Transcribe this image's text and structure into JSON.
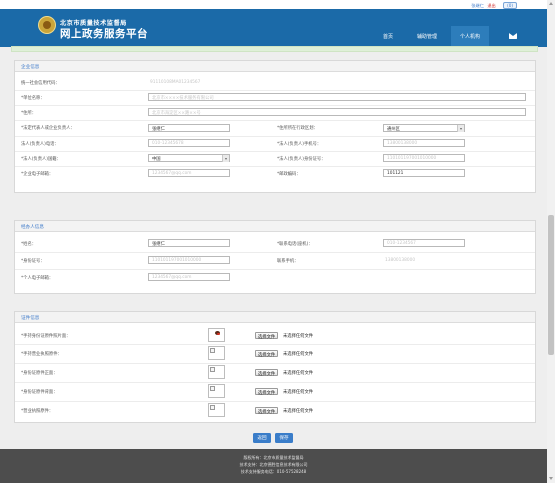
{
  "topbar": {
    "user": "张继仁",
    "logout": "退出",
    "badge": "(0)"
  },
  "header": {
    "org_name": "北京市质量技术监督局",
    "platform_name": "网上政务服务平台",
    "nav": [
      "首页",
      "辅助管理",
      "个人机构"
    ],
    "active_nav": "个人机构"
  },
  "enterprise": {
    "section_title": "企业信息",
    "credit_code_label": "统一社会信用代码：",
    "credit_code_value": "91110108MA01234567",
    "unit_name_label": "*单位名称：",
    "unit_name_value": "北京市××××技术服务有限公司",
    "address_label": "*住所：",
    "address_value": "北京市海淀区××路××号",
    "legal_rep_label": "*法定代表人或企业负责人：",
    "legal_rep_value": "张继仁",
    "district_label": "*住所所在行政区划：",
    "district_value": "通州区",
    "rep_phone_label": "法人(负责人)电话：",
    "rep_phone_value": "010-12345678",
    "rep_mobile_label": "*法人(负责人)手机号：",
    "rep_mobile_value": "13800138000",
    "nationality_label": "*法人(负责人)国籍：",
    "nationality_value": "中国",
    "rep_id_label": "*法人(负责人)身份证号：",
    "rep_id_value": "110101197001010000",
    "email_label": "*企业电子邮箱：",
    "email_value": "1234567@qq.com",
    "postcode_label": "*邮政编码：",
    "postcode_value": "101121"
  },
  "agent": {
    "section_title": "经办人信息",
    "name_label": "*姓名：",
    "name_value": "张继仁",
    "contact_label": "*联系电话(座机)：",
    "contact_value": "010-1234567",
    "id_label": "*身份证号：",
    "id_value": "110101197001010000",
    "mobile_label": "联系手机：",
    "mobile_value": "13800138000",
    "email_label": "*个人电子邮箱：",
    "email_value": "1234567@qq.com"
  },
  "certificates": {
    "section_title": "证件信息",
    "rows": [
      {
        "label": "*手持身份证原件照片面：",
        "button": "选择文件",
        "status": "未选择任何文件"
      },
      {
        "label": "*手持营业执照原件：",
        "button": "选择文件",
        "status": "未选择任何文件"
      },
      {
        "label": "*身份证原件正面：",
        "button": "选择文件",
        "status": "未选择任何文件"
      },
      {
        "label": "*身份证原件背面：",
        "button": "选择文件",
        "status": "未选择任何文件"
      },
      {
        "label": "*营业执照原件：",
        "button": "选择文件",
        "status": "未选择任何文件"
      }
    ]
  },
  "actions": {
    "back": "返回",
    "save": "保存"
  },
  "footer": {
    "line1": "版权所有：北京市质量技术监督局",
    "line2": "技术支持：北京德胜信息技术有限公司",
    "line3": "技术支持服务电话：010-57528248"
  },
  "colors": {
    "header": "#1b6aa8",
    "accent": "#3a7dc9",
    "footer": "#4d4d4d"
  }
}
